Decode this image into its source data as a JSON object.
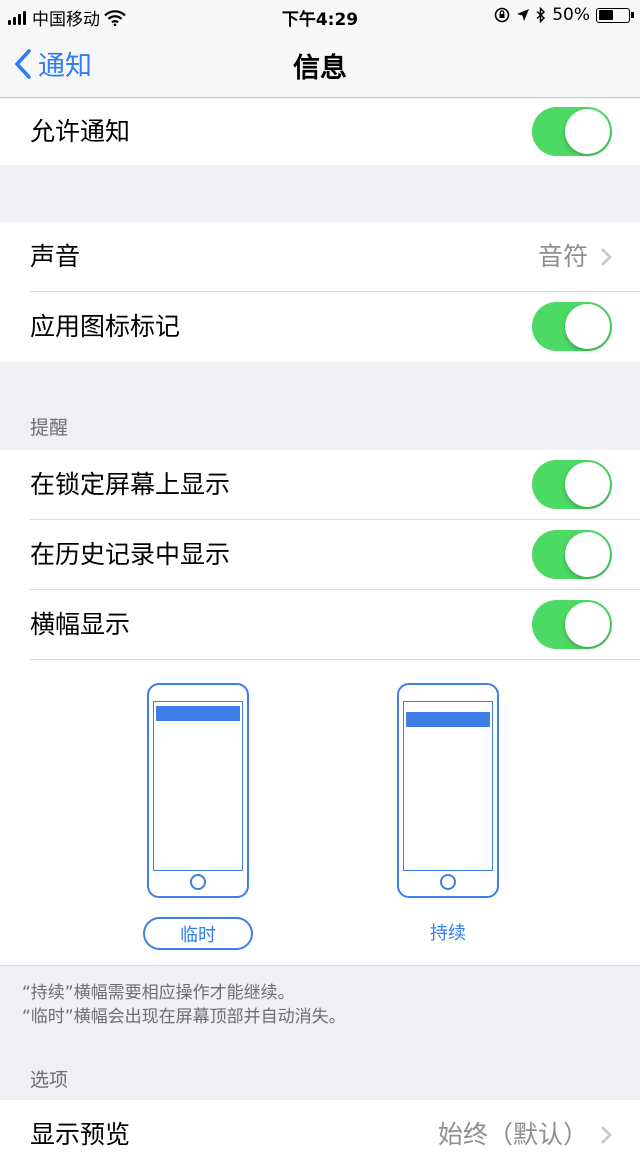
{
  "status_bar": {
    "carrier": "中国移动",
    "time": "下午4:29",
    "battery_percent_label": "50%",
    "battery_level": 0.5,
    "icons": [
      "signal-icon",
      "wifi-icon",
      "orientation-lock-icon",
      "location-icon",
      "bluetooth-icon",
      "battery-icon"
    ]
  },
  "nav": {
    "back_label": "通知",
    "title": "信息"
  },
  "settings": {
    "allow_notifications": {
      "label": "允许通知",
      "on": true
    },
    "sound": {
      "label": "声音",
      "value": "音符"
    },
    "badge_app_icon": {
      "label": "应用图标标记",
      "on": true
    }
  },
  "alerts": {
    "header": "提醒",
    "lock_screen": {
      "label": "在锁定屏幕上显示",
      "on": true
    },
    "history": {
      "label": "在历史记录中显示",
      "on": true
    },
    "banners": {
      "label": "横幅显示",
      "on": true
    },
    "banner_styles": [
      {
        "label": "临时",
        "selected": true
      },
      {
        "label": "持续",
        "selected": false
      }
    ],
    "footnote": [
      "“持续”横幅需要相应操作才能继续。",
      "“临时”横幅会出现在屏幕顶部并自动消失。"
    ]
  },
  "options": {
    "header": "选项",
    "show_previews": {
      "label": "显示预览",
      "value": "始终（默认）"
    }
  },
  "colors": {
    "accent": "#2f7cf6",
    "toggle_on": "#4cd964",
    "background": "#efeff4"
  }
}
